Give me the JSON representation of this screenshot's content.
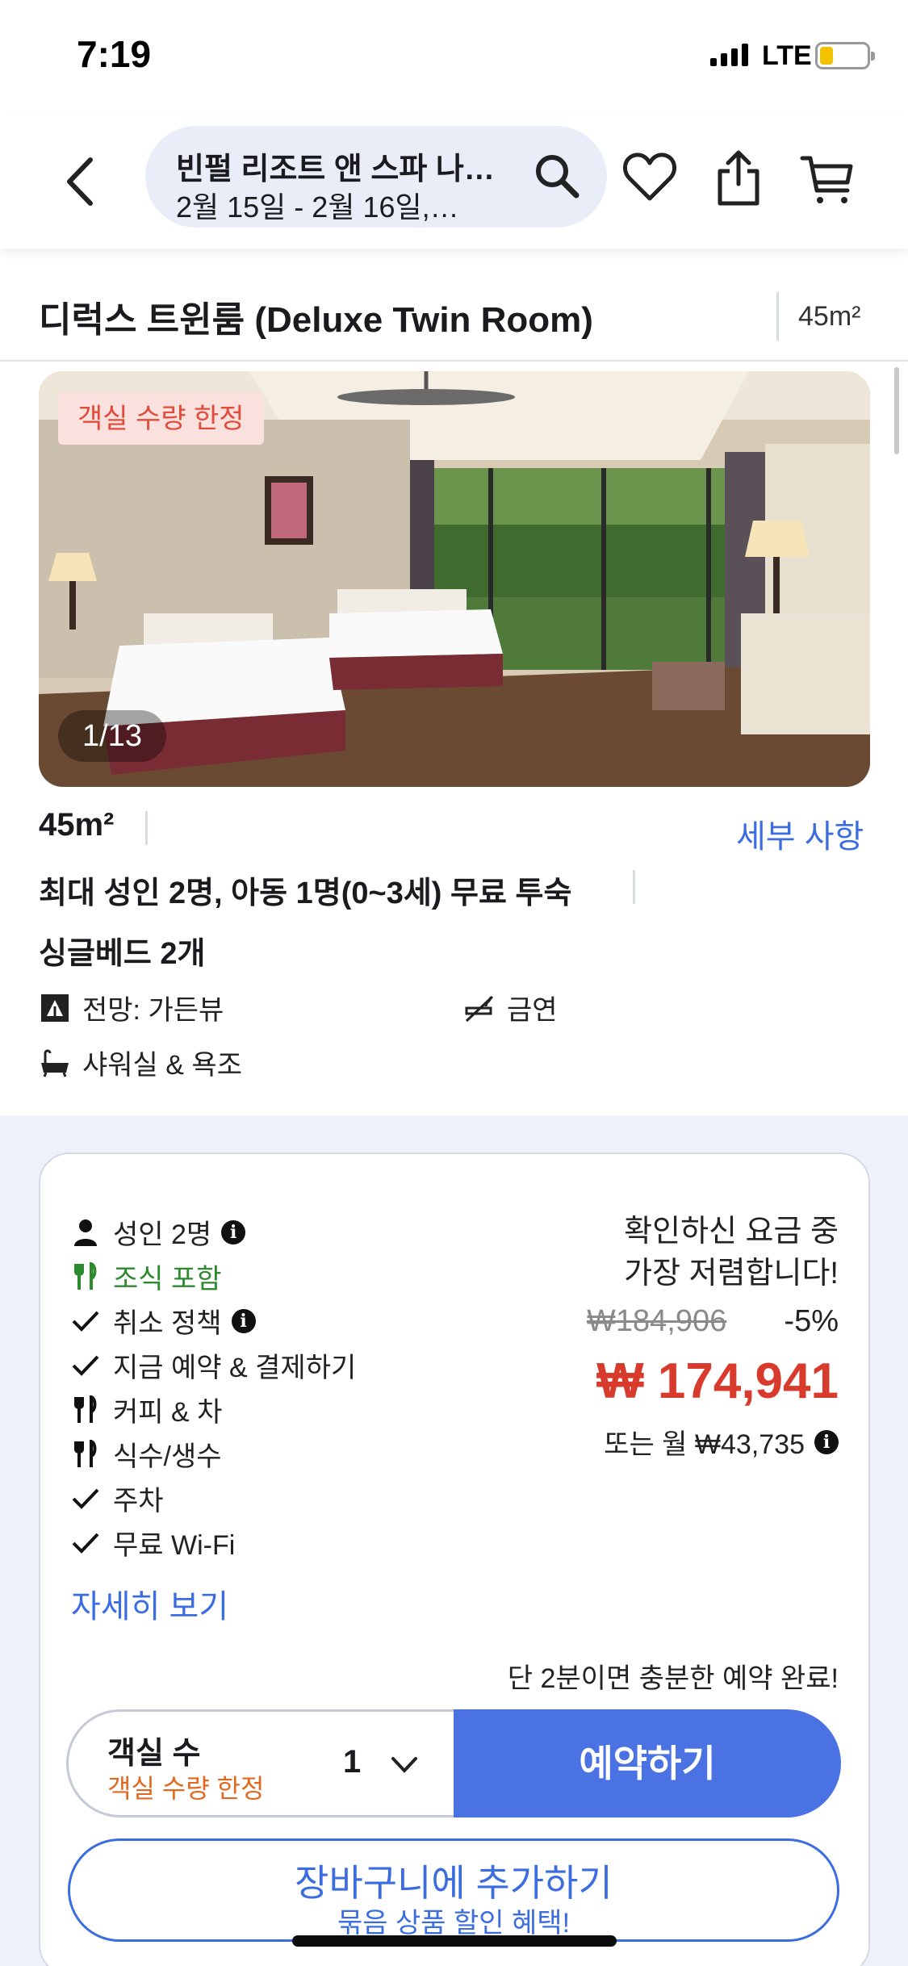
{
  "status_bar": {
    "time": "7:19",
    "network": "LTE"
  },
  "header": {
    "hotel_name": "빈펄 리조트 앤 스파 나…",
    "dates": "2월 15일 - 2월 16일,…",
    "icons": [
      "back-icon",
      "search-icon",
      "heart-icon",
      "share-icon",
      "cart-icon"
    ]
  },
  "room": {
    "title": "디럭스 트윈룸 (Deluxe Twin Room)",
    "title_area": "45m²",
    "limited_badge": "객실 수량 한정",
    "photo_counter": "1/13",
    "area": "45m²",
    "details_link": "세부 사항",
    "occupancy": "최대 성인 2명, 아동 1명(0~3세) 무료 투숙",
    "beds": "싱글베드 2개",
    "features": {
      "view": "전망: 가든뷰",
      "smoking": "금연",
      "bath": "샤워실 & 욕조"
    }
  },
  "offer": {
    "inclusions": {
      "adults": "성인 2명",
      "breakfast": "조식 포함",
      "cancellation": "취소 정책",
      "pay_now": "지금 예약 & 결제하기",
      "coffee": "커피 & 차",
      "water": "식수/생수",
      "parking": "주차",
      "wifi": "무료 Wi-Fi"
    },
    "more_link": "자세히 보기",
    "cheapest_line1": "확인하신 요금 중",
    "cheapest_line2": "가장 저렴합니다!",
    "original_price": "₩184,906",
    "discount": "-5%",
    "price": "₩ 174,941",
    "monthly": "또는 월 ₩43,735",
    "quick_note": "단 2분이면 충분한 예약 완료!",
    "rooms_label": "객실 수",
    "rooms_limited": "객실 수량 한정",
    "rooms_count": "1",
    "book_button": "예약하기",
    "cart_button": "장바구니에 추가하기",
    "cart_sub": "묶음 상품 할인 혜택!"
  },
  "colors": {
    "accent": "#4a72e3",
    "link": "#3b6de0",
    "price": "#d83a2c",
    "green": "#2e8a2e",
    "orange": "#e2681f"
  }
}
